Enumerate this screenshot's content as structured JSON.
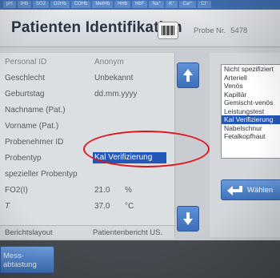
{
  "top_tabs": [
    "pH",
    "tHb",
    "SO2",
    "O2Hb",
    "COHb",
    "MetHb",
    "HHb",
    "HbF",
    "Na⁺",
    "K⁺",
    "Ca²⁺",
    "Cl⁻"
  ],
  "header": {
    "title": "Patienten Identifikation",
    "sample_label": "Probe Nr.",
    "sample_number": "5478"
  },
  "form": {
    "rows": [
      {
        "label": "Personal ID",
        "value": "Anonym",
        "unit": ""
      },
      {
        "label": "Geschlecht",
        "value": "Unbekannt",
        "unit": ""
      },
      {
        "label": "Geburtstag",
        "value": "dd.mm.yyyy",
        "unit": ""
      },
      {
        "label": "Nachname (Pat.)",
        "value": "",
        "unit": ""
      },
      {
        "label": "Vorname (Pat.)",
        "value": "",
        "unit": ""
      },
      {
        "label": "Probenehmer ID",
        "value": "",
        "unit": ""
      },
      {
        "label": "Probentyp",
        "value": "Kal Verifizierung",
        "unit": ""
      },
      {
        "label": "spezieller Probentyp",
        "value": "",
        "unit": ""
      },
      {
        "label": "FO2(I)",
        "value": "21.0",
        "unit": "%"
      },
      {
        "label": "T",
        "value": "37.0",
        "unit": "°C"
      }
    ],
    "report_label": "Berichtslayout",
    "report_value": "Patientenbericht US."
  },
  "sample_types": {
    "items": [
      "Nicht spezifiziert",
      "Arteriell",
      "Venös",
      "Kapillär",
      "Gemischt-venös",
      "Leistungstest",
      "Kal Verifizierung",
      "Nabelschnur",
      "Fetalkopfhaut"
    ],
    "selected_index": 6
  },
  "buttons": {
    "choose": "Wählen",
    "measure_line1": "Mess-",
    "measure_line2": "abtastung"
  },
  "colors": {
    "selection": "#2357b8",
    "annotation": "#e0151b",
    "button_blue": "#3f72bc"
  }
}
